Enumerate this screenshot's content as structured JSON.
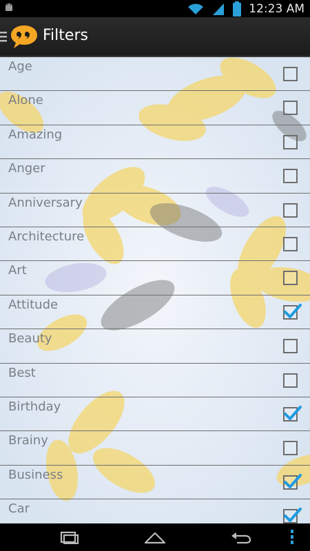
{
  "status_bar": {
    "time": "12:23 AM",
    "battery_level": "100",
    "icons": [
      "android-icon",
      "wifi-icon",
      "signal-icon",
      "battery-icon"
    ]
  },
  "action_bar": {
    "title": "Filters",
    "logo_icon": "quote-bubble-icon"
  },
  "filters": [
    {
      "label": "Age",
      "checked": false
    },
    {
      "label": "Alone",
      "checked": false
    },
    {
      "label": "Amazing",
      "checked": false
    },
    {
      "label": "Anger",
      "checked": false
    },
    {
      "label": "Anniversary",
      "checked": false
    },
    {
      "label": "Architecture",
      "checked": false
    },
    {
      "label": "Art",
      "checked": false
    },
    {
      "label": "Attitude",
      "checked": true
    },
    {
      "label": "Beauty",
      "checked": false
    },
    {
      "label": "Best",
      "checked": false
    },
    {
      "label": "Birthday",
      "checked": true
    },
    {
      "label": "Brainy",
      "checked": false
    },
    {
      "label": "Business",
      "checked": true
    },
    {
      "label": "Car",
      "checked": true
    }
  ],
  "nav_bar": {
    "icons": [
      "recent-apps-icon",
      "home-icon",
      "back-icon",
      "menu-icon"
    ]
  },
  "colors": {
    "accent_check": "#1e9be0",
    "logo_orange": "#f5a623"
  }
}
